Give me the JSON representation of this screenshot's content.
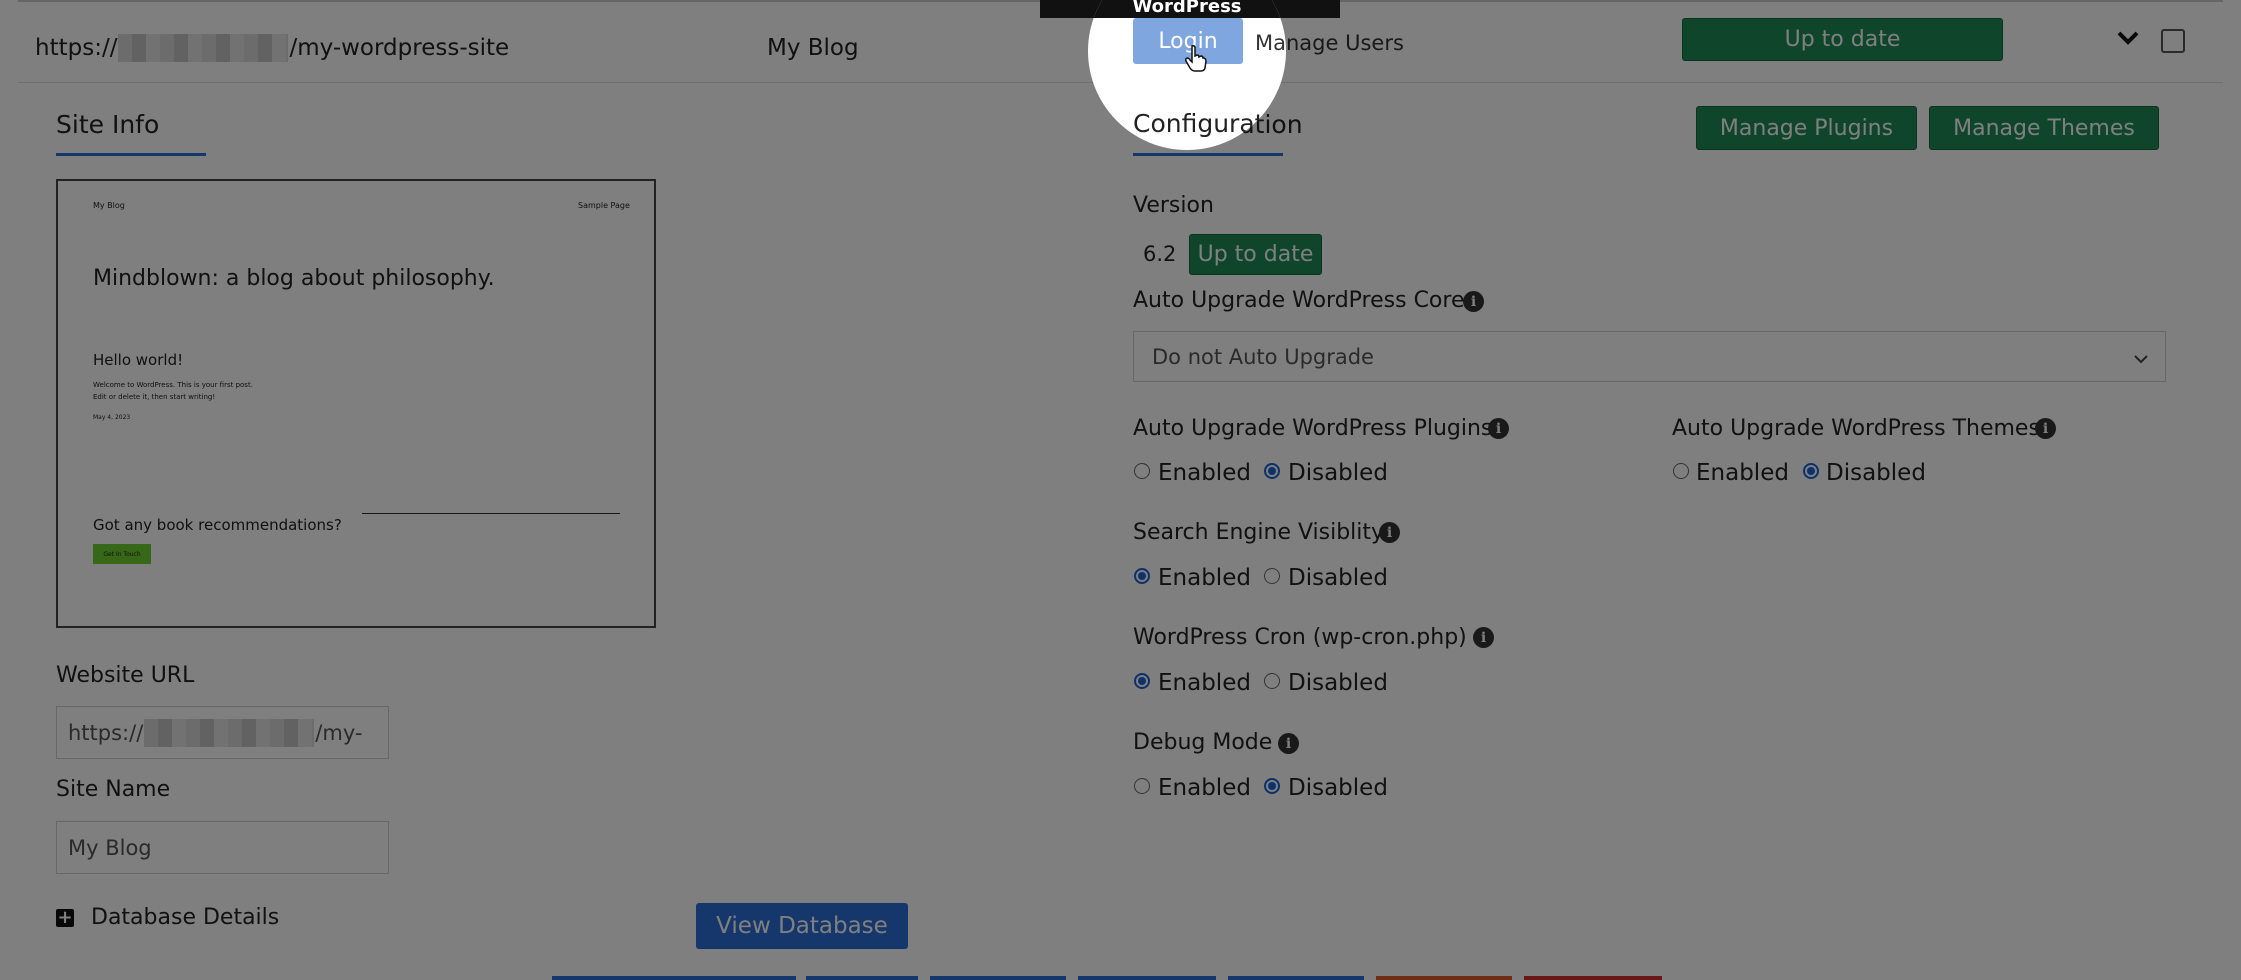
{
  "header": {
    "url_prefix": "https://",
    "url_suffix": "/my-wordpress-site",
    "site_name": "My Blog",
    "tooltip": "WordPress",
    "login_label": "Login",
    "manage_users_label": "Manage Users",
    "status_button": "Up to date"
  },
  "site_info": {
    "heading": "Site Info",
    "preview": {
      "nav_left": "My Blog",
      "nav_right": "Sample Page",
      "headline": "Mindblown: a blog about philosophy.",
      "post_title": "Hello world!",
      "post_line1": "Welcome to WordPress. This is your first post.",
      "post_line2": "Edit or delete it, then start writing!",
      "post_date": "May 4, 2023",
      "cta_text": "Got any book recommendations?",
      "cta_button": "Get In Touch"
    },
    "website_url_label": "Website URL",
    "website_url_prefix": "https://",
    "website_url_suffix": "/my-",
    "site_name_label": "Site Name",
    "site_name_value": "My Blog",
    "database_details_label": "Database Details",
    "view_database_label": "View Database"
  },
  "configuration": {
    "heading": "Configuration",
    "manage_plugins": "Manage Plugins",
    "manage_themes": "Manage Themes",
    "version_label": "Version",
    "version_value": "6.2",
    "version_status": "Up to date",
    "auto_upgrade_core_label": "Auto Upgrade WordPress Core",
    "auto_upgrade_core_value": "Do not Auto Upgrade",
    "plugins_label": "Auto Upgrade WordPress Plugins",
    "themes_label": "Auto Upgrade WordPress Themes",
    "search_label": "Search Engine Visiblity",
    "cron_label": "WordPress Cron (wp-cron.php)",
    "debug_label": "Debug Mode",
    "enabled": "Enabled",
    "disabled": "Disabled",
    "plugins_state": "Disabled",
    "themes_state": "Disabled",
    "search_state": "Enabled",
    "cron_state": "Enabled",
    "debug_state": "Disabled"
  },
  "colors": {
    "green": "#1c8b57",
    "blue": "#2d6fd8",
    "overlay": "rgba(0,0,0,0.5)"
  }
}
